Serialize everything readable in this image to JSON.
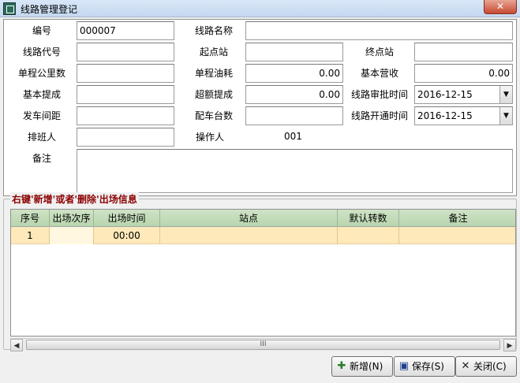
{
  "window": {
    "title": "线路管理登记",
    "close_glyph": "✕"
  },
  "form": {
    "labels": {
      "code": "编号",
      "route_name": "线路名称",
      "route_code": "线路代号",
      "start_station": "起点站",
      "end_station": "终点站",
      "one_way_km": "单程公里数",
      "one_way_fuel": "单程油耗",
      "base_revenue": "基本营收",
      "base_commission": "基本提成",
      "excess_commission": "超额提成",
      "approval_time": "线路审批时间",
      "departure_interval": "发车间距",
      "assigned_vehicles": "配车台数",
      "opening_time": "线路开通时间",
      "scheduler": "排班人",
      "operator": "操作人",
      "remarks": "备注"
    },
    "values": {
      "code": "000007",
      "one_way_fuel": "0.00",
      "base_revenue": "0.00",
      "excess_commission": "0.00",
      "approval_time": "2016-12-15",
      "opening_time": "2016-12-15",
      "operator": "001"
    },
    "combo_arrow": "▼"
  },
  "departures": {
    "group_title": "右键'新增'或者'删除'出场信息",
    "columns": [
      "序号",
      "出场次序",
      "出场时间",
      "站点",
      "默认转数",
      "备注"
    ],
    "rows": [
      {
        "seq": "1",
        "order": "",
        "time": "00:00",
        "station": "",
        "turns": "",
        "remark": ""
      }
    ],
    "scroll_left": "◀",
    "scroll_right": "▶",
    "scroll_grip": "III"
  },
  "buttons": {
    "add": "新增(N)",
    "save": "保存(S)",
    "close": "关闭(C)"
  }
}
